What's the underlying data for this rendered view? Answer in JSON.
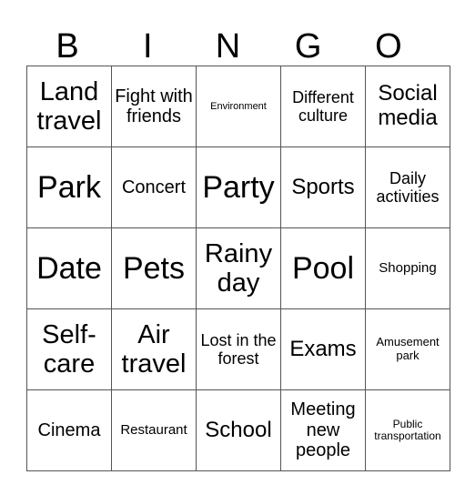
{
  "header": {
    "letters": [
      "B",
      "I",
      "N",
      "G",
      "O"
    ]
  },
  "grid": {
    "rows": [
      [
        "Land travel",
        "Fight with friends",
        "Environment",
        "Different culture",
        "Social media"
      ],
      [
        "Park",
        "Concert",
        "Party",
        "Sports",
        "Daily activities"
      ],
      [
        "Date",
        "Pets",
        "Rainy day",
        "Pool",
        "Shopping"
      ],
      [
        "Self-care",
        "Air travel",
        "Lost in the forest",
        "Exams",
        "Amusement park"
      ],
      [
        "Cinema",
        "Restaurant",
        "School",
        "Meeting new people",
        "Public transportation"
      ]
    ]
  }
}
